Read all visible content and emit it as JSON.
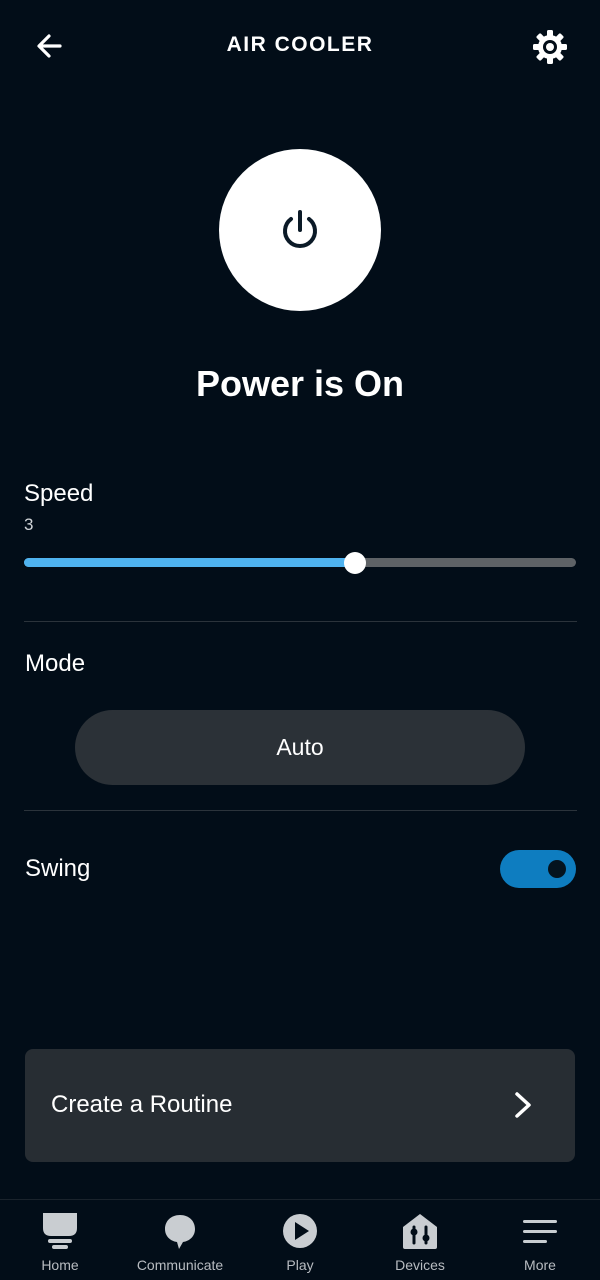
{
  "header": {
    "title": "AIR COOLER",
    "back_icon": "back-arrow-icon",
    "settings_icon": "gear-icon"
  },
  "power": {
    "icon": "power-icon",
    "status": "Power is On"
  },
  "speed": {
    "label": "Speed",
    "value": "3",
    "slider_fraction": 0.6,
    "accent_color": "#4fb3f0"
  },
  "mode": {
    "label": "Mode",
    "value": "Auto"
  },
  "swing": {
    "label": "Swing",
    "enabled": true,
    "toggle_color": "#0e7dc0"
  },
  "routine": {
    "label": "Create a Routine",
    "icon": "chevron-right-icon"
  },
  "nav": {
    "items": [
      {
        "label": "Home",
        "icon": "home-icon"
      },
      {
        "label": "Communicate",
        "icon": "chat-bubble-icon"
      },
      {
        "label": "Play",
        "icon": "play-icon"
      },
      {
        "label": "Devices",
        "icon": "devices-icon"
      },
      {
        "label": "More",
        "icon": "menu-icon"
      }
    ]
  }
}
